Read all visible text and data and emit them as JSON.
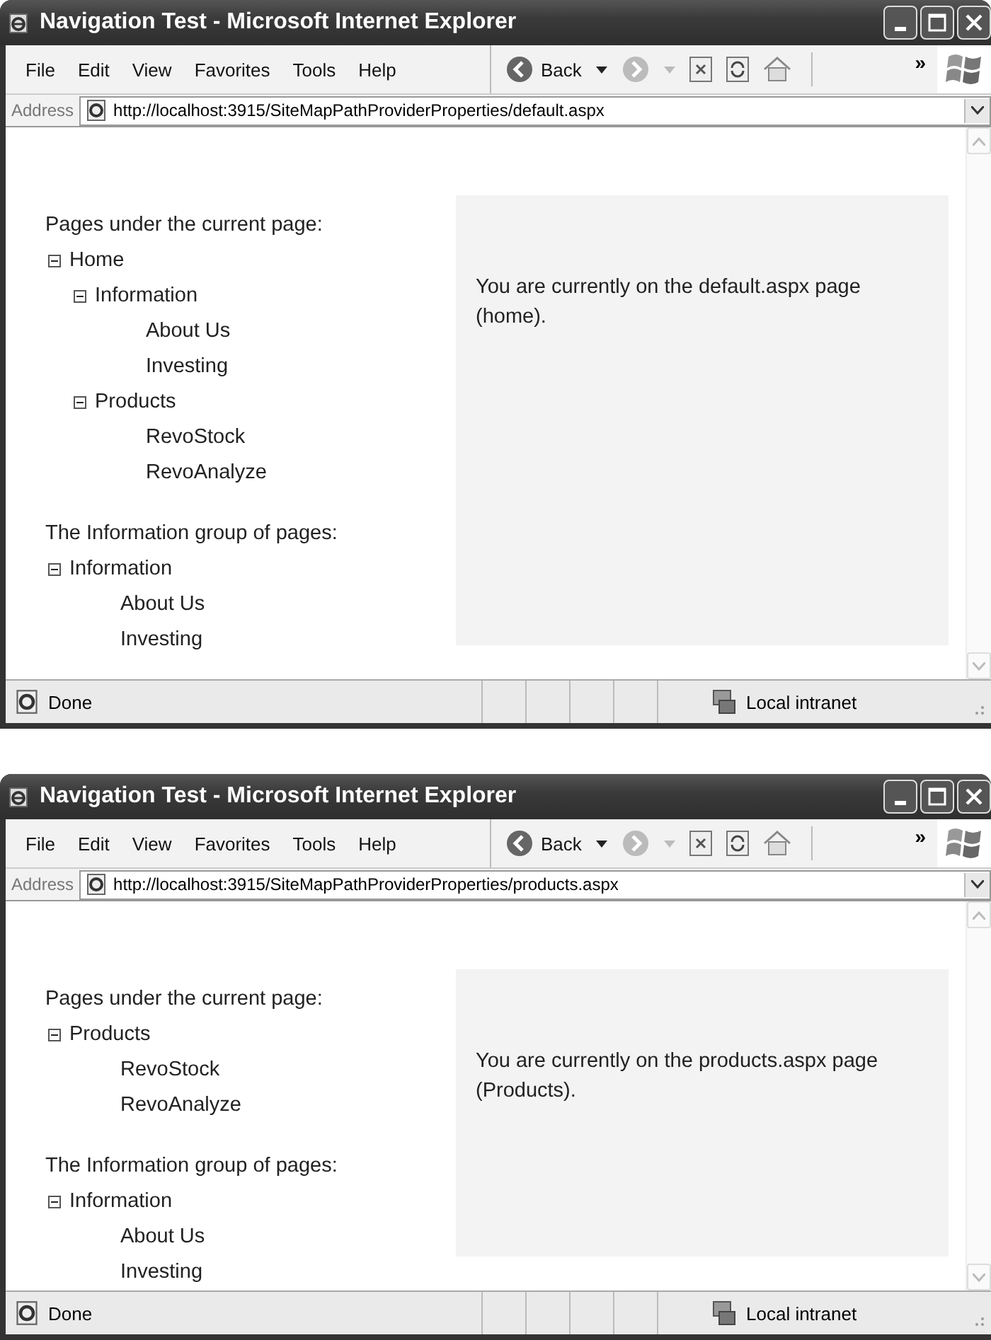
{
  "windows": [
    {
      "title": "Navigation Test - Microsoft Internet Explorer",
      "menu": [
        "File",
        "Edit",
        "View",
        "Favorites",
        "Tools",
        "Help"
      ],
      "toolbar": {
        "back_label": "Back",
        "more": "»"
      },
      "address": {
        "label": "Address",
        "url": "http://localhost:3915/SiteMapPathProviderProperties/default.aspx"
      },
      "sections": [
        {
          "heading": "Pages under the current page:",
          "tree": [
            {
              "label": "Home",
              "expanded": true,
              "children": [
                {
                  "label": "Information",
                  "expanded": true,
                  "children": [
                    {
                      "label": "About Us"
                    },
                    {
                      "label": "Investing"
                    }
                  ]
                },
                {
                  "label": "Products",
                  "expanded": true,
                  "children": [
                    {
                      "label": "RevoStock"
                    },
                    {
                      "label": "RevoAnalyze"
                    }
                  ]
                }
              ]
            }
          ]
        },
        {
          "heading": "The Information group of pages:",
          "tree": [
            {
              "label": "Information",
              "expanded": true,
              "children": [
                {
                  "label": "About Us"
                },
                {
                  "label": "Investing"
                }
              ]
            }
          ]
        }
      ],
      "message": "You are currently on the default.aspx page (home).",
      "status": {
        "text": "Done",
        "zone": "Local intranet"
      }
    },
    {
      "title": "Navigation Test - Microsoft Internet Explorer",
      "menu": [
        "File",
        "Edit",
        "View",
        "Favorites",
        "Tools",
        "Help"
      ],
      "toolbar": {
        "back_label": "Back",
        "more": "»"
      },
      "address": {
        "label": "Address",
        "url": "http://localhost:3915/SiteMapPathProviderProperties/products.aspx"
      },
      "sections": [
        {
          "heading": "Pages under the current page:",
          "tree": [
            {
              "label": "Products",
              "expanded": true,
              "children": [
                {
                  "label": "RevoStock"
                },
                {
                  "label": "RevoAnalyze"
                }
              ]
            }
          ]
        },
        {
          "heading": "The Information group of pages:",
          "tree": [
            {
              "label": "Information",
              "expanded": true,
              "children": [
                {
                  "label": "About Us"
                },
                {
                  "label": "Investing"
                }
              ]
            }
          ]
        }
      ],
      "message": "You are currently on the products.aspx page (Products).",
      "status": {
        "text": "Done",
        "zone": "Local intranet"
      }
    }
  ]
}
